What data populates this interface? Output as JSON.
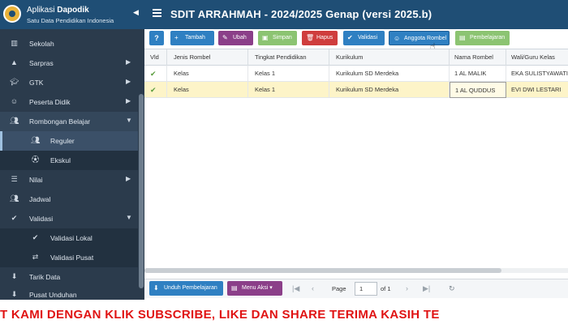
{
  "topbar": {
    "brand_prefix": "Aplikasi ",
    "brand_name": "Dapodik",
    "brand_sub": "Satu Data Pendidikan Indonesia",
    "title": "SDIT ARRAHMAH - 2024/2025 Genap (versi 2025.b)"
  },
  "sidebar": {
    "items": [
      {
        "label": "Sekolah"
      },
      {
        "label": "Sarpras"
      },
      {
        "label": "GTK"
      },
      {
        "label": "Peserta Didik"
      },
      {
        "label": "Rombongan Belajar"
      },
      {
        "label": "Reguler"
      },
      {
        "label": "Ekskul"
      },
      {
        "label": "Nilai"
      },
      {
        "label": "Jadwal"
      },
      {
        "label": "Validasi"
      },
      {
        "label": "Validasi Lokal"
      },
      {
        "label": "Validasi Pusat"
      },
      {
        "label": "Tarik Data"
      },
      {
        "label": "Pusat Unduhan"
      }
    ]
  },
  "toolbar": {
    "help": "?",
    "tambah": "Tambah",
    "ubah": "Ubah",
    "simpan": "Simpan",
    "hapus": "Hapus",
    "validasi": "Validasi",
    "anggota": "Anggota Rombel",
    "pembelajaran": "Pembelajaran"
  },
  "grid": {
    "columns": [
      "Vld",
      "Jenis Rombel",
      "Tingkat Pendidikan",
      "Kurikulum",
      "Nama Rombel",
      "Wali/Guru Kelas"
    ],
    "rows": [
      {
        "jenis": "Kelas",
        "tingkat": "Kelas 1",
        "kurikulum": "Kurikulum SD Merdeka",
        "nama": "1 AL MALIK",
        "wali": "EKA SULISTYAWATI"
      },
      {
        "jenis": "Kelas",
        "tingkat": "Kelas 1",
        "kurikulum": "Kurikulum SD Merdeka",
        "nama": "1 AL QUDDUS",
        "wali": "EVI DWI LESTARI"
      }
    ]
  },
  "bottombar": {
    "unduh": "Unduh Pembelajaran",
    "menu_aksi": "Menu Aksi",
    "page_label": "Page",
    "page_value": "1",
    "page_of": "of 1"
  },
  "banner": {
    "text": "T KAMI DENGAN KLIK SUBSCRIBE, LIKE DAN SHARE TERIMA KASIH TE"
  },
  "colors": {
    "topbar": "#1f4e75",
    "sidebar": "#2b3b4c",
    "primary": "#2f80c2",
    "purple": "#8b3f89",
    "green": "#8cc472",
    "red": "#cf3d3d",
    "banner_text": "#e01313",
    "selected_row": "#fdf4c8"
  }
}
